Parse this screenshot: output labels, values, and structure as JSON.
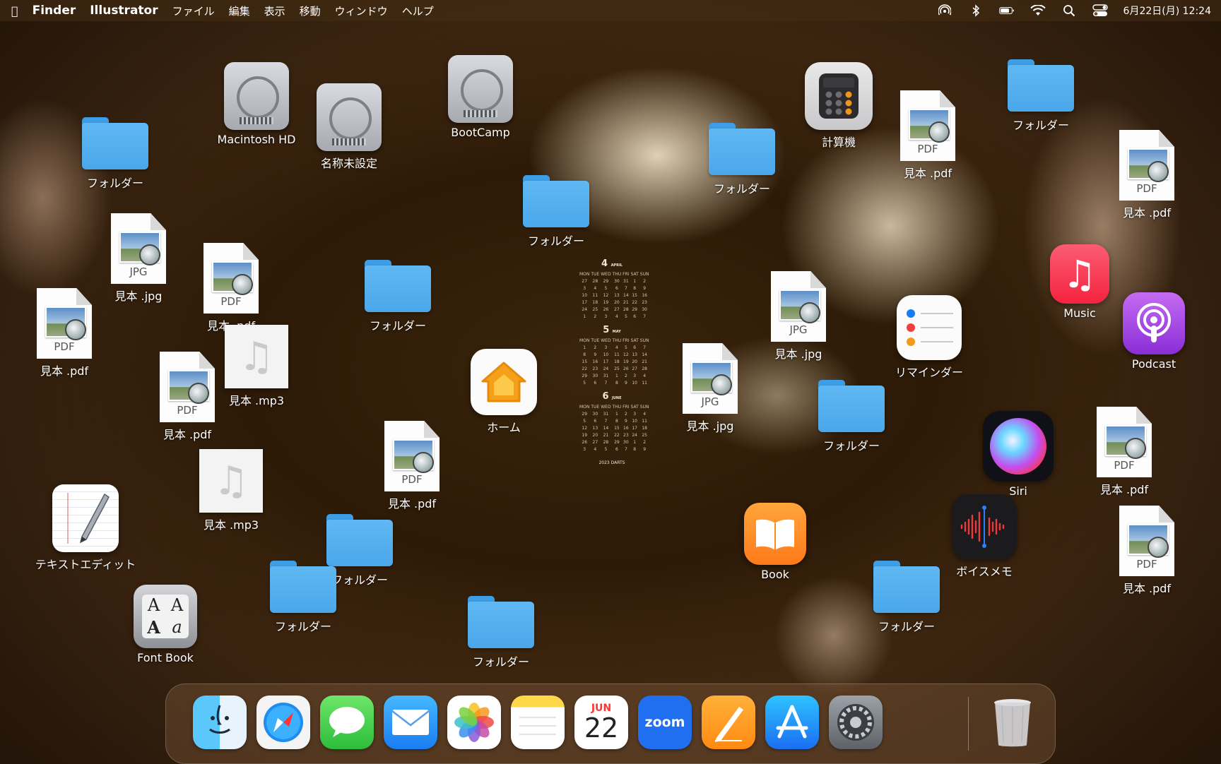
{
  "menubar": {
    "apple": "",
    "app_name": "Finder",
    "app2": "Illustrator",
    "menus": [
      "ファイル",
      "編集",
      "表示",
      "移動",
      "ウィンドウ",
      "ヘルプ"
    ],
    "datetime": "6月22日(月) 12:24",
    "status_icons": [
      "airdrop-icon",
      "bluetooth-icon",
      "battery-icon",
      "wifi-icon",
      "search-icon",
      "control-center-icon"
    ]
  },
  "desktop": {
    "folder_label": "フォルダー",
    "drives": [
      "Macintosh HD",
      "名称未設定",
      "BootCamp"
    ],
    "pdf_label": "見本 .pdf",
    "jpg_label": "見本 .jpg",
    "mp3_label": "見本 .mp3",
    "pdf_tag": "PDF",
    "jpg_tag": "JPG",
    "apps": {
      "calculator": "計算機",
      "music": "Music",
      "podcast": "Podcast",
      "reminders": "リマインダー",
      "home": "ホーム",
      "siri": "Siri",
      "book": "Book",
      "voice_memo": "ボイスメモ",
      "textedit": "テキストエディット",
      "fontbook": "Font Book"
    }
  },
  "calendar_widget": {
    "months": [
      {
        "num": "4",
        "name": "APRIL",
        "days": [
          "MON",
          "TUE",
          "WED",
          "THU",
          "FRI",
          "SAT",
          "SUN",
          "27",
          "28",
          "29",
          "30",
          "31",
          "1",
          "2",
          "3",
          "4",
          "5",
          "6",
          "7",
          "8",
          "9",
          "10",
          "11",
          "12",
          "13",
          "14",
          "15",
          "16",
          "17",
          "18",
          "19",
          "20",
          "21",
          "22",
          "23",
          "24",
          "25",
          "26",
          "27",
          "28",
          "29",
          "30",
          "1",
          "2",
          "3",
          "4",
          "5",
          "6",
          "7"
        ]
      },
      {
        "num": "5",
        "name": "MAY",
        "days": [
          "MON",
          "TUE",
          "WED",
          "THU",
          "FRI",
          "SAT",
          "SUN",
          "1",
          "2",
          "3",
          "4",
          "5",
          "6",
          "7",
          "8",
          "9",
          "10",
          "11",
          "12",
          "13",
          "14",
          "15",
          "16",
          "17",
          "18",
          "19",
          "20",
          "21",
          "22",
          "23",
          "24",
          "25",
          "26",
          "27",
          "28",
          "29",
          "30",
          "31",
          "1",
          "2",
          "3",
          "4",
          "5",
          "6",
          "7",
          "8",
          "9",
          "10",
          "11"
        ]
      },
      {
        "num": "6",
        "name": "JUNE",
        "days": [
          "MON",
          "TUE",
          "WED",
          "THU",
          "FRI",
          "SAT",
          "SUN",
          "29",
          "30",
          "31",
          "1",
          "2",
          "3",
          "4",
          "5",
          "6",
          "7",
          "8",
          "9",
          "10",
          "11",
          "12",
          "13",
          "14",
          "15",
          "16",
          "17",
          "18",
          "19",
          "20",
          "21",
          "22",
          "23",
          "24",
          "25",
          "26",
          "27",
          "28",
          "29",
          "30",
          "1",
          "2",
          "3",
          "4",
          "5",
          "6",
          "7",
          "8",
          "9"
        ]
      }
    ],
    "footer": "2023 DARTS"
  },
  "dock": {
    "items": [
      "Finder",
      "Safari",
      "Messages",
      "Mail",
      "Photos",
      "Notes",
      "Calendar",
      "Zoom",
      "Pages",
      "App Store",
      "System Preferences",
      "Trash"
    ],
    "calendar_month": "JUN",
    "calendar_day": "22",
    "zoom_text": "zoom"
  }
}
